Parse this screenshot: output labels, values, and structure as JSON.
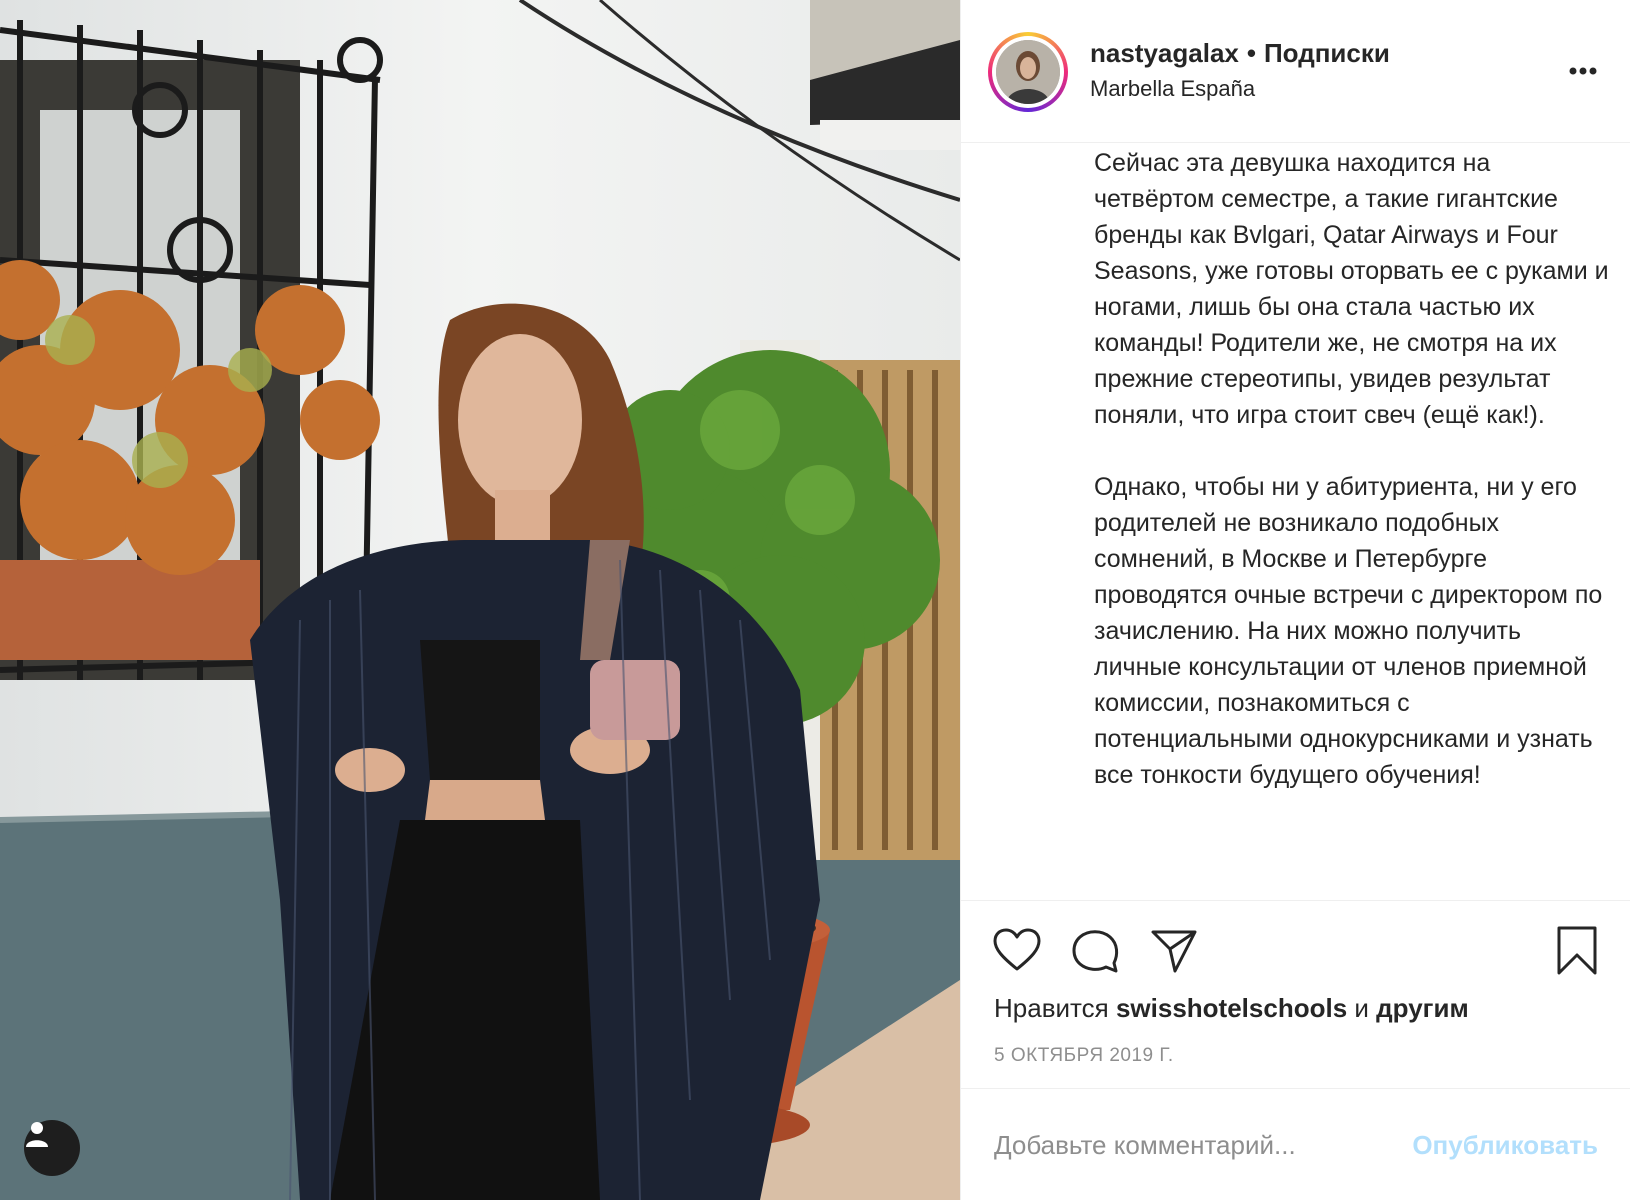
{
  "post": {
    "username": "nastyagalax",
    "follow_label": "Подписки",
    "location": "Marbella España",
    "caption": [
      "Сейчас эта девушка находится на четвёртом семестре, а такие гигантские бренды как Bvlgari, Qatar Airways и Four Seasons, уже готовы оторвать ее с руками и ногами, лишь бы она стала частью их команды! Родители же, не смотря на их прежние стереотипы, увидев результат поняли, что игра стоит свеч (ещё как!).",
      "Однако, чтобы ни у абитуриента, ни у его родителей не возникало подобных сомнений, в Москве и Петербурге проводятся очные встречи с директором по зачислению. На них можно получить личные консультации от членов приемной комиссии, познакомиться с потенциальными однокурсниками и узнать все тонкости будущего обучения!"
    ],
    "likes": {
      "prefix": "Нравится",
      "user": "swisshotelschools",
      "conj": "и",
      "others": "другим"
    },
    "date": "5 ОКТЯБРЯ 2019 Г."
  },
  "comment": {
    "placeholder": "Добавьте комментарий...",
    "publish_label": "Опубликовать"
  },
  "icons": {
    "more": "more-options-icon",
    "like": "heart-icon",
    "comment": "comment-icon",
    "share": "share-icon",
    "save": "bookmark-icon",
    "tag": "user-tag-icon"
  },
  "colors": {
    "text": "#262626",
    "secondary": "#8e8e8e",
    "border": "#efefef",
    "publish_disabled": "#b2dffc"
  }
}
